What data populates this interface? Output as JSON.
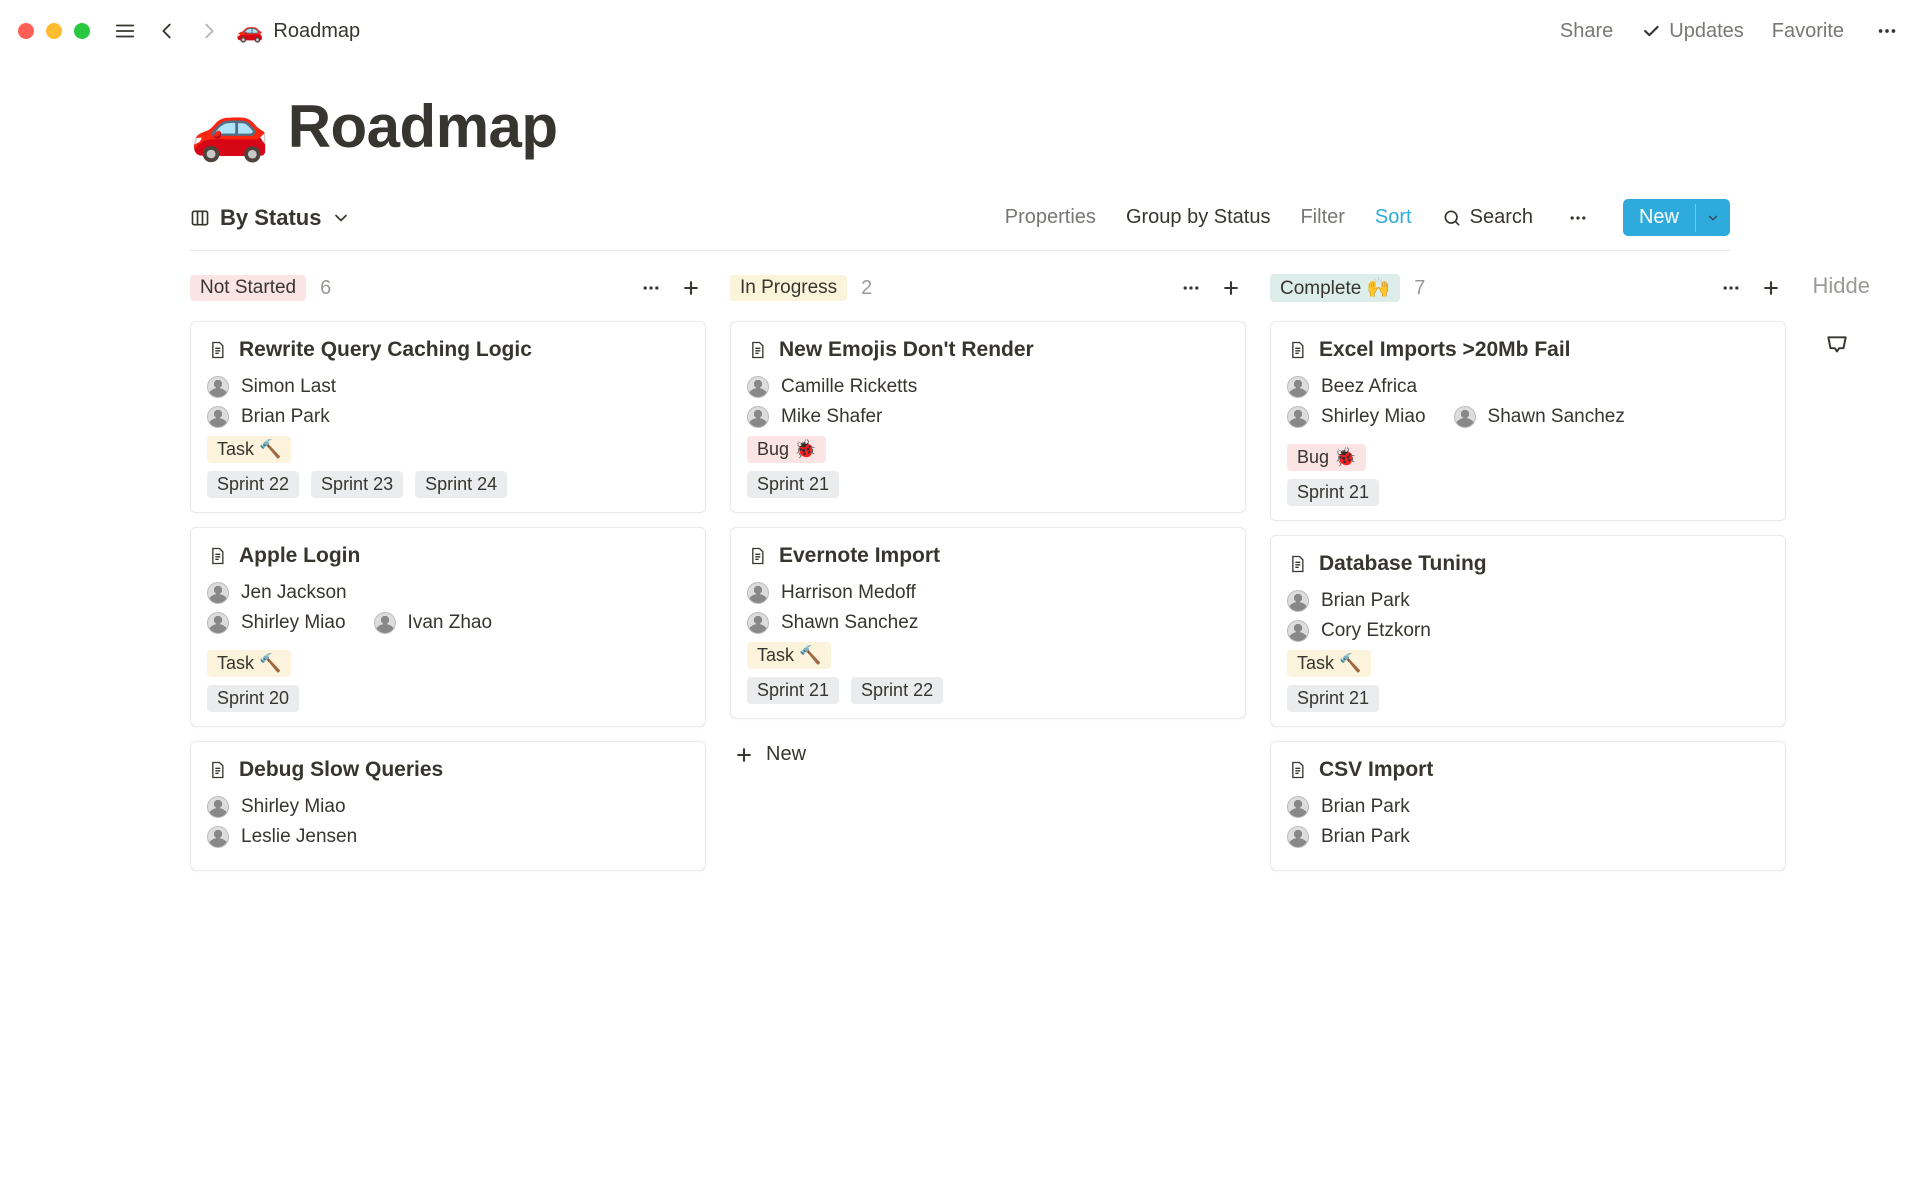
{
  "breadcrumb": {
    "emoji": "🚗",
    "title": "Roadmap"
  },
  "top_actions": {
    "share": "Share",
    "updates": "Updates",
    "favorite": "Favorite"
  },
  "page_title": {
    "emoji": "🚗",
    "text": "Roadmap"
  },
  "viewbar": {
    "view_name": "By Status",
    "properties": "Properties",
    "groupby_prefix": "Group by ",
    "groupby_value": "Status",
    "filter": "Filter",
    "sort": "Sort",
    "search": "Search",
    "new": "New"
  },
  "hidden_label": "Hidde",
  "columns": [
    {
      "id": "not_started",
      "label": "Not Started",
      "color": "red",
      "count": "6"
    },
    {
      "id": "in_progress",
      "label": "In Progress",
      "color": "yellow",
      "count": "2"
    },
    {
      "id": "complete",
      "label": "Complete 🙌",
      "color": "green",
      "count": "7"
    }
  ],
  "cards": {
    "not_started": [
      {
        "title": "Rewrite Query Caching Logic",
        "people": [
          [
            "Simon Last"
          ],
          [
            "Brian Park"
          ]
        ],
        "type": "Task 🔨",
        "type_kind": "task",
        "sprints": [
          "Sprint 22",
          "Sprint 23",
          "Sprint 24"
        ]
      },
      {
        "title": "Apple Login",
        "people": [
          [
            "Jen Jackson"
          ],
          [
            "Shirley Miao",
            "Ivan Zhao"
          ]
        ],
        "type": "Task 🔨",
        "type_kind": "task",
        "sprints": [
          "Sprint 20"
        ]
      },
      {
        "title": "Debug Slow Queries",
        "people": [
          [
            "Shirley Miao"
          ],
          [
            "Leslie Jensen"
          ]
        ],
        "type": "",
        "type_kind": "",
        "sprints": []
      }
    ],
    "in_progress": [
      {
        "title": "New Emojis Don't Render",
        "people": [
          [
            "Camille Ricketts"
          ],
          [
            "Mike Shafer"
          ]
        ],
        "type": "Bug 🐞",
        "type_kind": "bug",
        "sprints": [
          "Sprint 21"
        ]
      },
      {
        "title": "Evernote Import",
        "people": [
          [
            "Harrison Medoff"
          ],
          [
            "Shawn Sanchez"
          ]
        ],
        "type": "Task 🔨",
        "type_kind": "task",
        "sprints": [
          "Sprint 21",
          "Sprint 22"
        ]
      }
    ],
    "complete": [
      {
        "title": "Excel Imports >20Mb Fail",
        "people": [
          [
            "Beez Africa"
          ],
          [
            "Shirley Miao",
            "Shawn Sanchez"
          ]
        ],
        "type": "Bug 🐞",
        "type_kind": "bug",
        "sprints": [
          "Sprint 21"
        ]
      },
      {
        "title": "Database Tuning",
        "people": [
          [
            "Brian Park"
          ],
          [
            "Cory Etzkorn"
          ]
        ],
        "type": "Task 🔨",
        "type_kind": "task",
        "sprints": [
          "Sprint 21"
        ]
      },
      {
        "title": "CSV Import",
        "people": [
          [
            "Brian Park"
          ],
          [
            "Brian Park"
          ]
        ],
        "type": "",
        "type_kind": "",
        "sprints": []
      }
    ]
  },
  "add_new_label": "New"
}
